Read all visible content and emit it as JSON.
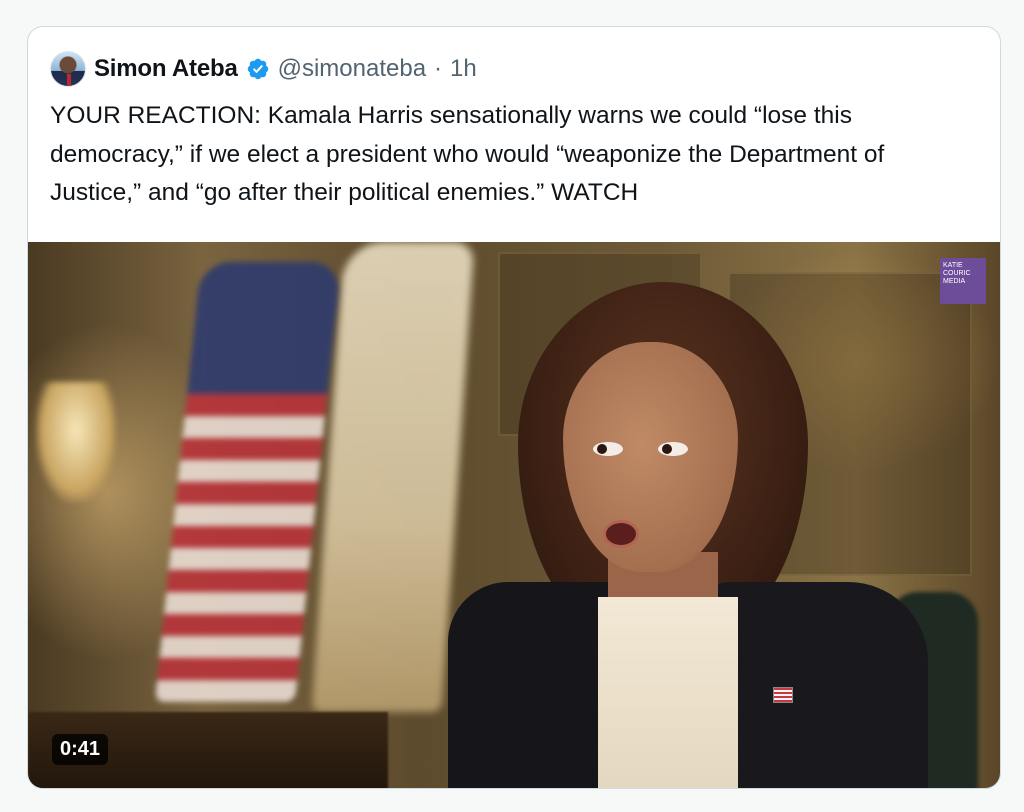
{
  "tweet": {
    "author_name": "Simon Ateba",
    "handle": "@simonateba",
    "separator": "·",
    "time": "1h",
    "verified": true,
    "verified_color": "#1d9bf0",
    "text": "YOUR REACTION: Kamala Harris sensationally warns we could “lose this democracy,” if we elect a president who would “weaponize the Department of Justice,” and “go after their political enemies.” WATCH"
  },
  "video": {
    "duration": "0:41",
    "watermark": "KATIE COURIC MEDIA",
    "watermark_color": "#6d4c9a"
  },
  "icons": {
    "verified": "verified-badge-icon",
    "avatar": "author-avatar"
  }
}
